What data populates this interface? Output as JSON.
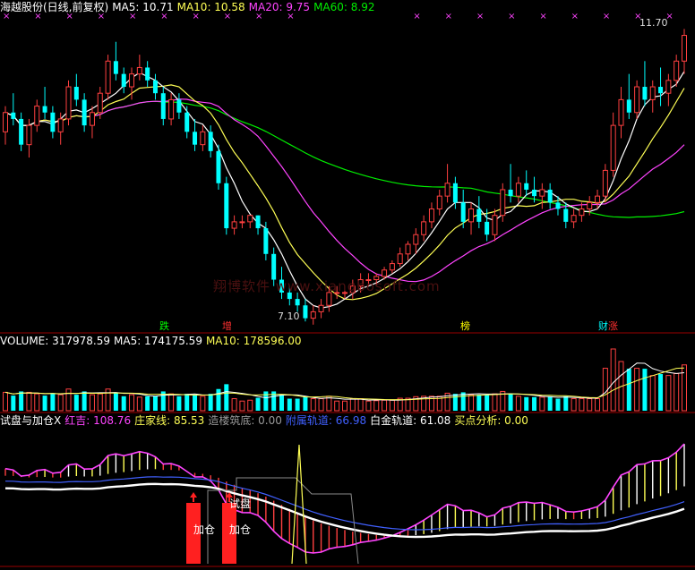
{
  "colors": {
    "bg": "#000000",
    "frame": "#9a0000",
    "up": "#ff4040",
    "down": "#00ffff",
    "ma5": "#ffffff",
    "ma10": "#ffff55",
    "ma20": "#ff44ff",
    "ma60": "#00ee00",
    "cross": "#ff44ff"
  },
  "price_panel": {
    "title": "海越股份(日线,前复权)",
    "ma5_label": "MA5: 10.71",
    "ma10_label": "MA10: 10.58",
    "ma20_label": "MA20: 9.75",
    "ma60_label": "MA60: 8.92",
    "high_label": "11.70",
    "low_label": "7.10",
    "signals": [
      {
        "text": "跌",
        "color": "#00ff00"
      },
      {
        "text": "增",
        "color": "#ff3030"
      },
      {
        "text": "榜",
        "color": "#ffff00"
      },
      {
        "text": "财",
        "color": "#00ffff"
      },
      {
        "text": "涨",
        "color": "#ff3030"
      }
    ],
    "watermark": "翔博软件 www.xiangbosoft.com"
  },
  "volume_panel": {
    "volume_label": "VOLUME: 317978.59",
    "ma5_label": "MA5: 174175.59",
    "ma10_label": "MA10: 178596.00"
  },
  "indicator_panel": {
    "name": "试盘与加仓X",
    "items": [
      {
        "text": "红吉: 108.76",
        "color": "#ff44ff"
      },
      {
        "text": "庄家线: 85.53",
        "color": "#ffff55"
      },
      {
        "text": "造楼筑底: 0.00",
        "color": "#9a9a9a"
      },
      {
        "text": "附属轨道: 66.98",
        "color": "#4060ff"
      },
      {
        "text": "白金轨道: 61.08",
        "color": "#ffffff"
      },
      {
        "text": "买点分析: 0.00",
        "color": "#ffff55"
      }
    ],
    "labels": [
      "试盘",
      "加仓",
      "试盘",
      "加仓"
    ]
  },
  "chart_data": {
    "type": "candlestick",
    "ylim": [
      7.0,
      11.9
    ],
    "candles": [
      [
        10.1,
        10.5,
        9.9,
        10.4
      ],
      [
        10.4,
        10.7,
        10.2,
        10.3
      ],
      [
        10.3,
        10.4,
        9.8,
        9.9
      ],
      [
        9.9,
        10.3,
        9.7,
        10.2
      ],
      [
        10.2,
        10.6,
        10.1,
        10.5
      ],
      [
        10.5,
        10.8,
        10.3,
        10.4
      ],
      [
        10.4,
        10.5,
        10.0,
        10.1
      ],
      [
        10.1,
        10.4,
        9.9,
        10.3
      ],
      [
        10.3,
        10.9,
        10.2,
        10.8
      ],
      [
        10.8,
        11.0,
        10.5,
        10.6
      ],
      [
        10.6,
        10.7,
        10.1,
        10.2
      ],
      [
        10.2,
        10.5,
        10.0,
        10.4
      ],
      [
        10.4,
        10.8,
        10.3,
        10.7
      ],
      [
        10.7,
        11.3,
        10.6,
        11.2
      ],
      [
        11.2,
        11.5,
        10.9,
        11.0
      ],
      [
        11.0,
        11.1,
        10.7,
        10.8
      ],
      [
        10.8,
        11.1,
        10.6,
        11.0
      ],
      [
        11.0,
        11.3,
        10.9,
        11.1
      ],
      [
        11.1,
        11.2,
        10.8,
        10.9
      ],
      [
        10.9,
        11.0,
        10.6,
        10.7
      ],
      [
        10.7,
        10.8,
        10.2,
        10.3
      ],
      [
        10.3,
        10.7,
        10.2,
        10.6
      ],
      [
        10.6,
        10.7,
        10.3,
        10.4
      ],
      [
        10.4,
        10.5,
        10.0,
        10.1
      ],
      [
        10.1,
        10.3,
        9.8,
        9.9
      ],
      [
        9.9,
        10.2,
        9.8,
        10.1
      ],
      [
        10.1,
        10.2,
        9.7,
        9.8
      ],
      [
        9.8,
        9.9,
        9.2,
        9.3
      ],
      [
        9.3,
        9.4,
        8.5,
        8.6
      ],
      [
        8.6,
        8.8,
        8.5,
        8.7
      ],
      [
        8.7,
        8.8,
        8.6,
        8.7
      ],
      [
        8.7,
        8.8,
        8.6,
        8.8
      ],
      [
        8.8,
        8.8,
        8.5,
        8.6
      ],
      [
        8.6,
        8.7,
        8.1,
        8.2
      ],
      [
        8.2,
        8.3,
        7.7,
        7.8
      ],
      [
        7.8,
        8.0,
        7.5,
        7.6
      ],
      [
        7.6,
        7.7,
        7.4,
        7.5
      ],
      [
        7.5,
        7.6,
        7.3,
        7.4
      ],
      [
        7.4,
        7.5,
        7.15,
        7.2
      ],
      [
        7.2,
        7.4,
        7.1,
        7.3
      ],
      [
        7.3,
        7.5,
        7.2,
        7.4
      ],
      [
        7.4,
        7.7,
        7.3,
        7.6
      ],
      [
        7.6,
        7.7,
        7.5,
        7.6
      ],
      [
        7.6,
        7.7,
        7.5,
        7.6
      ],
      [
        7.6,
        7.8,
        7.5,
        7.7
      ],
      [
        7.7,
        7.9,
        7.6,
        7.8
      ],
      [
        7.8,
        7.9,
        7.7,
        7.8
      ],
      [
        7.8,
        7.9,
        7.7,
        7.85
      ],
      [
        7.85,
        8.0,
        7.8,
        7.95
      ],
      [
        7.95,
        8.1,
        7.9,
        8.05
      ],
      [
        8.05,
        8.3,
        8.0,
        8.2
      ],
      [
        8.2,
        8.4,
        8.1,
        8.35
      ],
      [
        8.35,
        8.6,
        8.2,
        8.5
      ],
      [
        8.5,
        8.8,
        8.4,
        8.7
      ],
      [
        8.7,
        9.0,
        8.6,
        8.9
      ],
      [
        8.9,
        9.2,
        8.8,
        9.1
      ],
      [
        9.1,
        9.6,
        9.0,
        9.3
      ],
      [
        9.3,
        9.4,
        8.9,
        9.0
      ],
      [
        9.0,
        9.2,
        8.6,
        8.7
      ],
      [
        8.7,
        9.0,
        8.5,
        8.9
      ],
      [
        8.9,
        9.1,
        8.6,
        8.7
      ],
      [
        8.7,
        8.9,
        8.4,
        8.5
      ],
      [
        8.5,
        8.9,
        8.4,
        8.8
      ],
      [
        8.8,
        9.3,
        8.7,
        9.2
      ],
      [
        9.2,
        9.6,
        9.0,
        9.1
      ],
      [
        9.1,
        9.4,
        9.0,
        9.3
      ],
      [
        9.3,
        9.5,
        9.1,
        9.2
      ],
      [
        9.2,
        9.4,
        9.0,
        9.1
      ],
      [
        9.1,
        9.3,
        8.9,
        9.2
      ],
      [
        9.2,
        9.3,
        8.9,
        9.0
      ],
      [
        9.0,
        9.1,
        8.8,
        8.9
      ],
      [
        8.9,
        9.0,
        8.6,
        8.7
      ],
      [
        8.7,
        8.9,
        8.6,
        8.8
      ],
      [
        8.8,
        9.0,
        8.7,
        8.9
      ],
      [
        8.9,
        9.1,
        8.8,
        9.0
      ],
      [
        9.0,
        9.2,
        8.9,
        9.1
      ],
      [
        9.1,
        9.6,
        9.0,
        9.5
      ],
      [
        9.5,
        10.4,
        9.4,
        10.2
      ],
      [
        10.2,
        10.8,
        10.0,
        10.6
      ],
      [
        10.6,
        11.0,
        10.3,
        10.4
      ],
      [
        10.4,
        10.9,
        10.3,
        10.8
      ],
      [
        10.8,
        11.2,
        10.5,
        10.6
      ],
      [
        10.6,
        10.9,
        10.4,
        10.8
      ],
      [
        10.8,
        11.1,
        10.5,
        10.7
      ],
      [
        10.7,
        11.0,
        10.5,
        10.9
      ],
      [
        10.9,
        11.3,
        10.8,
        11.2
      ],
      [
        11.2,
        11.7,
        11.0,
        11.6
      ]
    ]
  }
}
